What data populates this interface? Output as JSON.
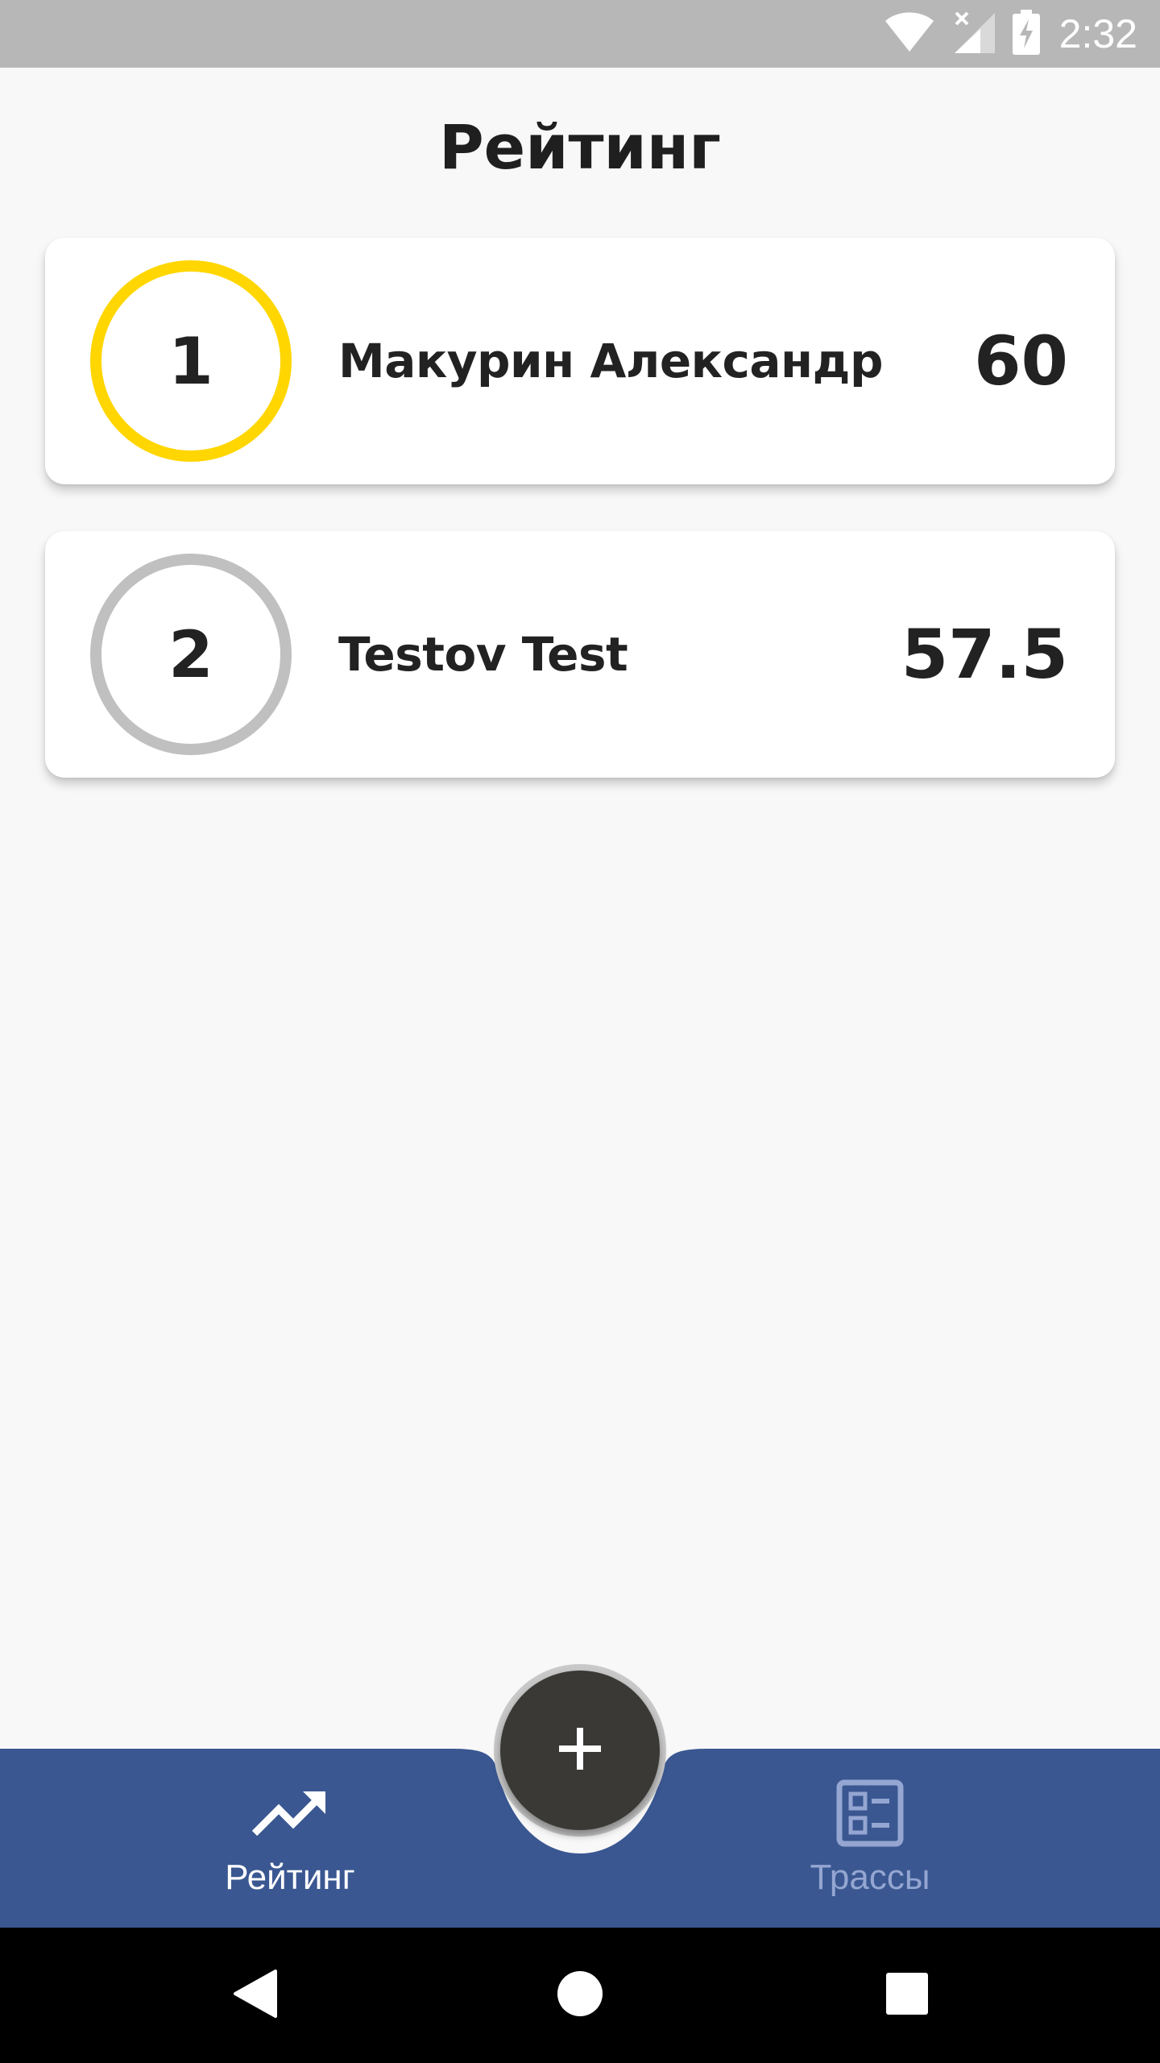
{
  "status_bar": {
    "time": "2:32",
    "icons": [
      "wifi-icon",
      "signal-icon",
      "battery-charging-icon"
    ]
  },
  "page": {
    "title": "Рейтинг"
  },
  "leaderboard": [
    {
      "rank": "1",
      "name": "Макурин Александр",
      "score": "60",
      "ring_color": "#ffd600"
    },
    {
      "rank": "2",
      "name": "Testov Test",
      "score": "57.5",
      "ring_color": "#c0c0c0"
    }
  ],
  "bottom_nav": {
    "background": "#3a5791",
    "items": [
      {
        "label": "Рейтинг",
        "icon": "trending-up-icon",
        "active": true
      },
      {
        "label": "Трассы",
        "icon": "list-icon",
        "active": false
      }
    ],
    "fab_icon": "plus-icon"
  },
  "system_nav": {
    "buttons": [
      "back-icon",
      "home-icon",
      "recents-icon"
    ]
  }
}
